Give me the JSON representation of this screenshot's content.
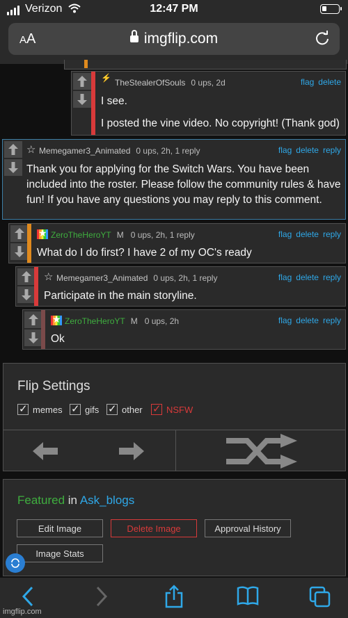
{
  "status_bar": {
    "carrier": "Verizon",
    "time": "12:47 PM"
  },
  "browser": {
    "text_size_label_small": "A",
    "text_size_label_large": "A",
    "url": "imgflip.com"
  },
  "comments": [
    {
      "user": "TheStealerOfSouls",
      "meta": "0 ups, 2d",
      "actions": [
        "flag",
        "delete"
      ],
      "text_lines": [
        "I see.",
        "",
        "I posted the vine video. No copyright! (Thank god)"
      ],
      "bar_color": "#d83a3a",
      "avatar": "bolt-icon"
    },
    {
      "user": "Memegamer3_Animated",
      "meta": "0 ups, 2h, 1 reply",
      "actions": [
        "flag",
        "delete",
        "reply"
      ],
      "text": "Thank you for applying for the Switch Wars. You have been included into the roster. Please follow the community rules & have fun! If you have any questions you may reply to this comment.",
      "avatar": "star-icon"
    },
    {
      "user": "ZeroTheHeroYT",
      "tag": "M",
      "meta": "0 ups, 2h, 1 reply",
      "actions": [
        "flag",
        "delete",
        "reply"
      ],
      "text": "What do I do first? I have 2 of my OC's ready",
      "bar_color": "#e08a1e",
      "avatar": "rainbow-star-icon"
    },
    {
      "user": "Memegamer3_Animated",
      "meta": "0 ups, 2h, 1 reply",
      "actions": [
        "flag",
        "delete",
        "reply"
      ],
      "text": "Participate in the main storyline.",
      "bar_color": "#d83a3a",
      "avatar": "star-icon"
    },
    {
      "user": "ZeroTheHeroYT",
      "tag": "M",
      "meta": "0 ups, 2h",
      "actions": [
        "flag",
        "delete",
        "reply"
      ],
      "text": "Ok",
      "bar_color": "#7a4a4a",
      "avatar": "rainbow-star-icon"
    }
  ],
  "flip_settings": {
    "title": "Flip Settings",
    "options": [
      {
        "label": "memes",
        "checked": true
      },
      {
        "label": "gifs",
        "checked": true
      },
      {
        "label": "other",
        "checked": true
      },
      {
        "label": "NSFW",
        "checked": true
      }
    ]
  },
  "featured": {
    "prefix": "Featured",
    "joiner": "in",
    "stream": "Ask_blogs",
    "buttons": [
      "Edit Image",
      "Delete Image",
      "Approval History",
      "Image Stats"
    ]
  },
  "watermark": "imgflip.com",
  "colors": {
    "link": "#2fa8e8",
    "green": "#3fae3f",
    "danger": "#d83a3a",
    "orange": "#e08a1e"
  }
}
